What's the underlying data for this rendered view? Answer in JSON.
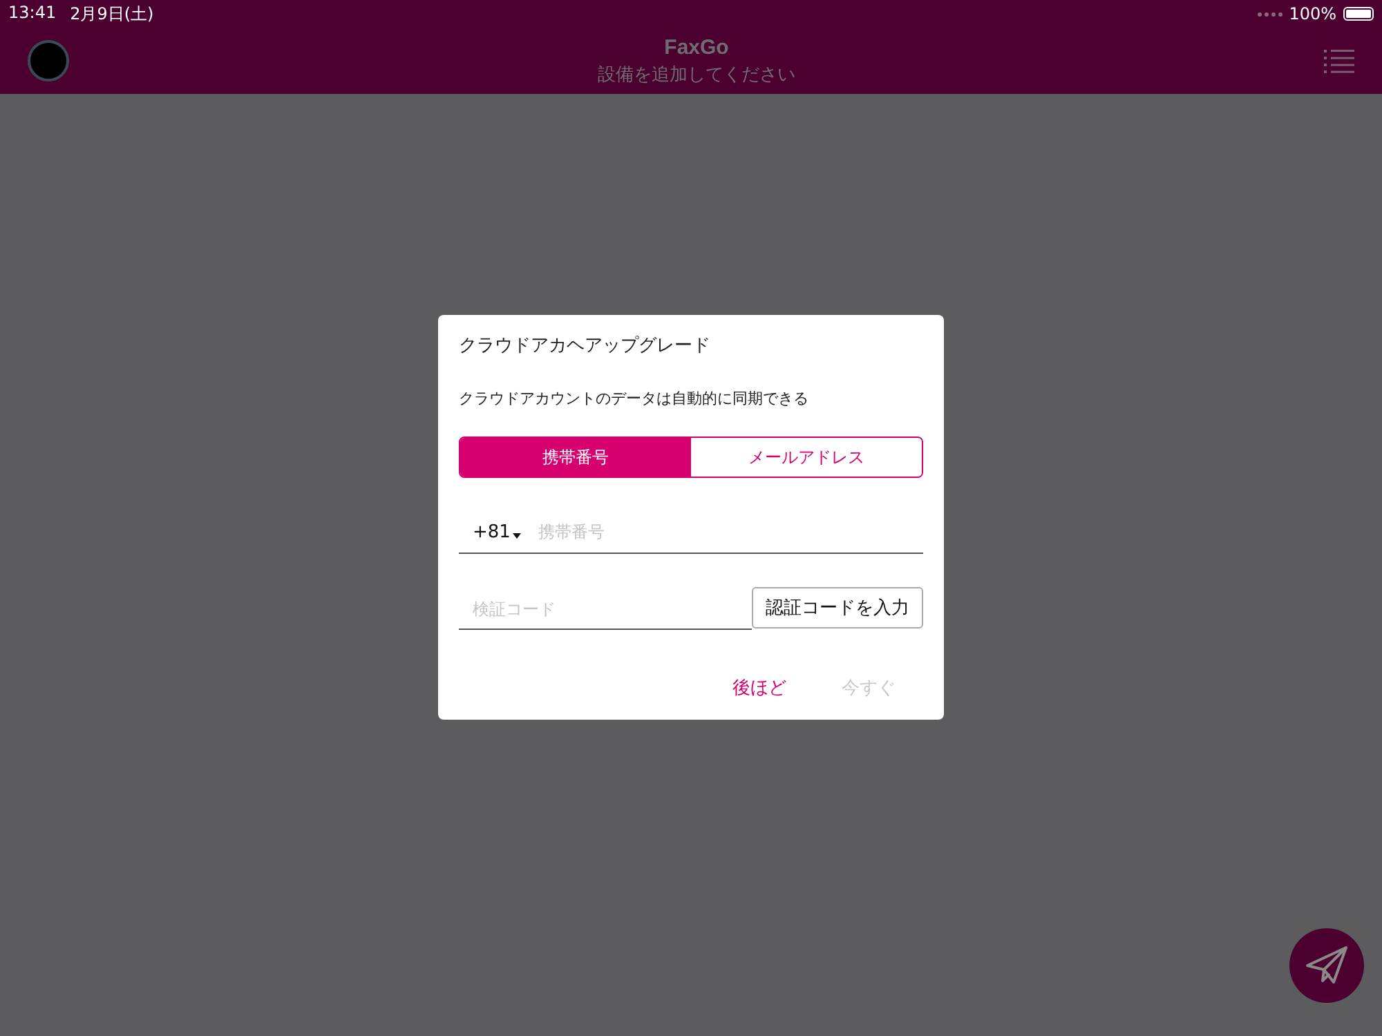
{
  "status_bar": {
    "time": "13:41",
    "date": "2月9日(土)",
    "battery": "100%"
  },
  "header": {
    "title": "FaxGo",
    "subtitle": "設備を追加してください"
  },
  "dialog": {
    "title": "クラウドアカヘアップグレード",
    "message": "クラウドアカウントのデータは自動的に同期できる",
    "tabs": [
      {
        "label": "携帯番号",
        "selected": true
      },
      {
        "label": "メールアドレス",
        "selected": false
      }
    ],
    "phone": {
      "country_code": "+81",
      "placeholder": "携帯番号"
    },
    "code": {
      "placeholder": "検証コード",
      "button": "認証コードを入力"
    },
    "actions": [
      {
        "label": "後ほど",
        "disabled": false
      },
      {
        "label": "今すぐ",
        "disabled": true
      }
    ]
  }
}
